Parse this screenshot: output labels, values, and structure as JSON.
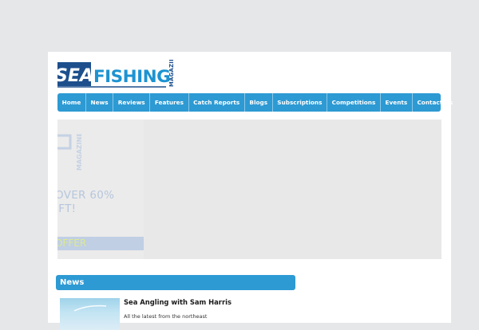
{
  "brand": {
    "logo_sea": "SEA",
    "logo_fishing": "FISHING",
    "logo_magazine": "MAGAZINE"
  },
  "nav": {
    "items": [
      {
        "label": "Home"
      },
      {
        "label": "News"
      },
      {
        "label": "Reviews"
      },
      {
        "label": "Features"
      },
      {
        "label": "Catch Reports"
      },
      {
        "label": "Blogs"
      },
      {
        "label": "Subscriptions"
      },
      {
        "label": "Competitions"
      },
      {
        "label": "Events"
      },
      {
        "label": "Contact Us"
      }
    ]
  },
  "promo": {
    "mag_text": "MAGAZINE",
    "line1": "OVER 60%",
    "line2": "IFT!",
    "offer": "OFFER"
  },
  "news": {
    "header": "News",
    "items": [
      {
        "title": "Sea Angling with Sam Harris",
        "excerpt": "All the latest from the northeast"
      }
    ]
  },
  "colors": {
    "accent": "#2e9ad3",
    "logo_dark": "#1c4f8c",
    "page_bg": "#e6e7e8"
  }
}
